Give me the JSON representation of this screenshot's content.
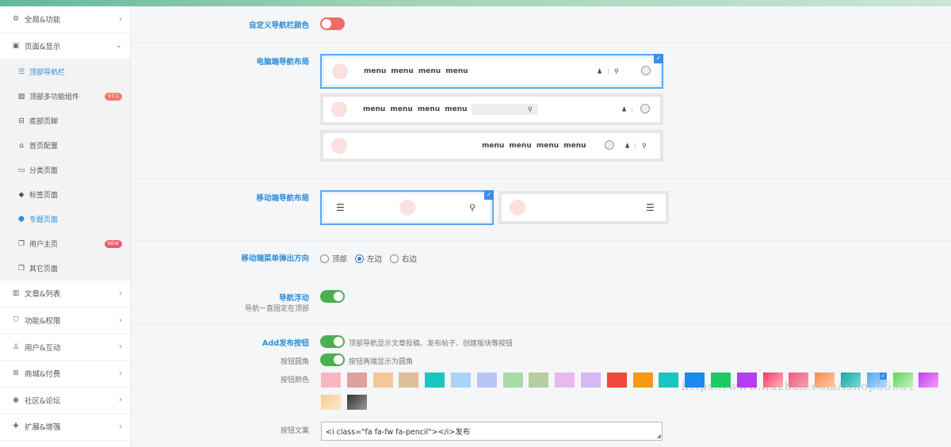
{
  "sidebar": {
    "items": [
      {
        "label": "全局&功能",
        "icon": "gear-icon",
        "glyph": "⚙"
      },
      {
        "label": "页面&显示",
        "icon": "calendar-icon",
        "glyph": "▣",
        "expanded": true
      }
    ],
    "sub_items": [
      {
        "label": "顶部导航栏",
        "icon": "menu-icon",
        "glyph": "☰",
        "active": true
      },
      {
        "label": "顶部多功能组件",
        "icon": "image-icon",
        "glyph": "▨",
        "badge": "V7.1"
      },
      {
        "label": "底部页脚",
        "icon": "footer-icon",
        "glyph": "⊟"
      },
      {
        "label": "首页配置",
        "icon": "home-icon",
        "glyph": "⌂"
      },
      {
        "label": "分类页面",
        "icon": "folder-icon",
        "glyph": "▭"
      },
      {
        "label": "标签页面",
        "icon": "tags-icon",
        "glyph": "◆"
      },
      {
        "label": "专题页面",
        "icon": "cube-icon",
        "glyph": "⬢"
      },
      {
        "label": "用户主页",
        "icon": "copy-icon",
        "glyph": "❐",
        "badge": "NEW"
      },
      {
        "label": "其它页面",
        "icon": "copy-icon",
        "glyph": "❐"
      }
    ],
    "bottom_items": [
      {
        "label": "文章&列表",
        "icon": "map-icon",
        "glyph": "▥"
      },
      {
        "label": "功能&权限",
        "icon": "shield-icon",
        "glyph": "⛉"
      },
      {
        "label": "用户&互动",
        "icon": "user-icon",
        "glyph": "♙"
      },
      {
        "label": "商城&付费",
        "icon": "cart-icon",
        "glyph": "⊞"
      },
      {
        "label": "社区&论坛",
        "icon": "compass-icon",
        "glyph": "◉"
      },
      {
        "label": "扩展&增强",
        "icon": "puzzle-icon",
        "glyph": "✚"
      }
    ],
    "arrow_right": "›",
    "arrow_down": "⌄"
  },
  "settings": {
    "nav_color": {
      "label": "自定义导航栏颜色",
      "enabled": false
    },
    "pc_layout": {
      "label": "电脑端导航布局",
      "menu_text": "menu menu menu menu",
      "user_glyph": "♟",
      "divider_glyph": "|",
      "search_glyph": "⚲",
      "check_glyph": "✓"
    },
    "mobile_layout": {
      "label": "移动端导航布局",
      "hamburger_glyph": "☰",
      "search_glyph": "⚲"
    },
    "mobile_menu_direction": {
      "label": "移动端菜单弹出方向",
      "options": [
        "顶部",
        "左边",
        "右边"
      ],
      "selected": 1
    },
    "nav_float": {
      "label": "导航浮动",
      "sublabel": "导航一直固定在顶部",
      "enabled": true
    },
    "publish_button": {
      "label": "Add发布按钮",
      "enabled": true,
      "desc": "顶部导航显示文章投稿、发布帖子、创建版块等按钮"
    },
    "button_round": {
      "label": "按钮圆角",
      "enabled": true,
      "desc": "按钮两端显示为圆角"
    },
    "button_color": {
      "label": "按钮颜色",
      "colors": [
        "#f7b6c2",
        "#e0a0a0",
        "#f6c59a",
        "#ddc09a",
        "#1ac6c0",
        "#a9d3f7",
        "#b9c6f5",
        "#a8dba8",
        "#b5cfa0",
        "#e8b8f0",
        "#d5b9f0",
        "#f0473e",
        "#f49a14",
        "#1bc6c0",
        "#1d88f0",
        "#1ec966",
        "#b43ef0",
        "linear-gradient(135deg,#f36,#fbb)",
        "linear-gradient(135deg,#f25a7a,#f7a0b5)",
        "linear-gradient(135deg,#f68b50,#fbc9a0)",
        "linear-gradient(135deg,#14a7a7,#7fd6d6)",
        "linear-gradient(135deg,#5aa8f0,#b5d9fa)",
        "linear-gradient(135deg,#62d35a,#c8f0c3)",
        "linear-gradient(135deg,#c13cf0,#f2a0f5)",
        "linear-gradient(135deg,#f6cd90,#fbe9cf)",
        "linear-gradient(135deg,#333,#999)"
      ],
      "selected": 21
    },
    "button_text": {
      "label": "按钮文案",
      "value": "<i class=\"fa fa-fw fa-pencil\"></i>发布",
      "resize_glyph": "◢"
    }
  },
  "watermark": "https://www.huzhan.com/ishop35381"
}
